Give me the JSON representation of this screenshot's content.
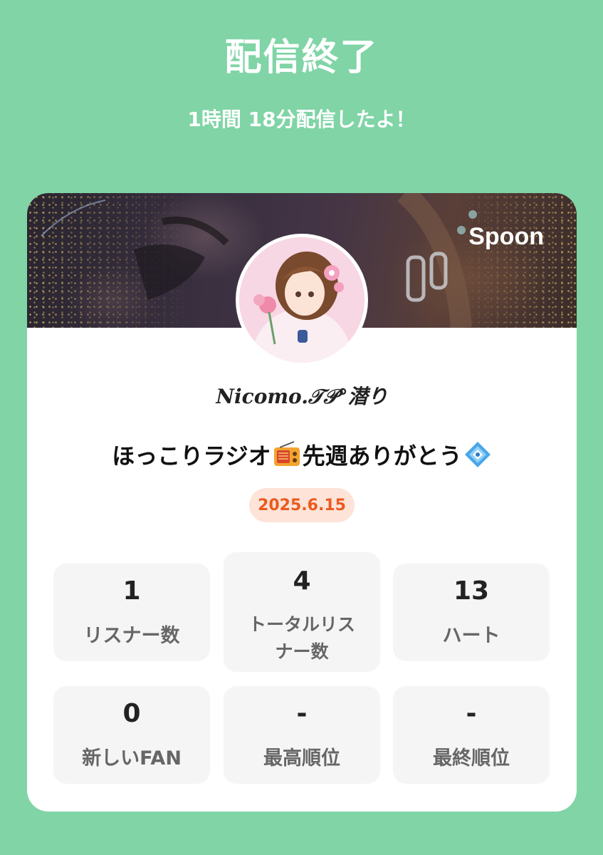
{
  "header": {
    "title": "配信終了",
    "subtitle": "1時間 18分配信したよ！"
  },
  "card": {
    "brand": "Spoon",
    "host_name": "Nicomo.𝒯𝒫°潜り",
    "show_title": "ほっこりラジオ",
    "show_title_suffix": "先週ありがとう",
    "date": "2025.6.15",
    "stats": [
      {
        "value": "1",
        "label": "リスナー数"
      },
      {
        "value": "4",
        "label_line1": "トータルリス",
        "label_line2": "ナー数"
      },
      {
        "value": "13",
        "label": "ハート"
      },
      {
        "value": "0",
        "label": "新しいFAN"
      },
      {
        "value": "-",
        "label": "最高順位"
      },
      {
        "value": "-",
        "label": "最終順位"
      }
    ]
  },
  "icons": [
    "radio-emoji-icon",
    "diamond-emoji-icon"
  ],
  "colors": {
    "background": "#80d4a6",
    "date_text": "#ec5a1e",
    "date_bg": "#fde3d8"
  }
}
